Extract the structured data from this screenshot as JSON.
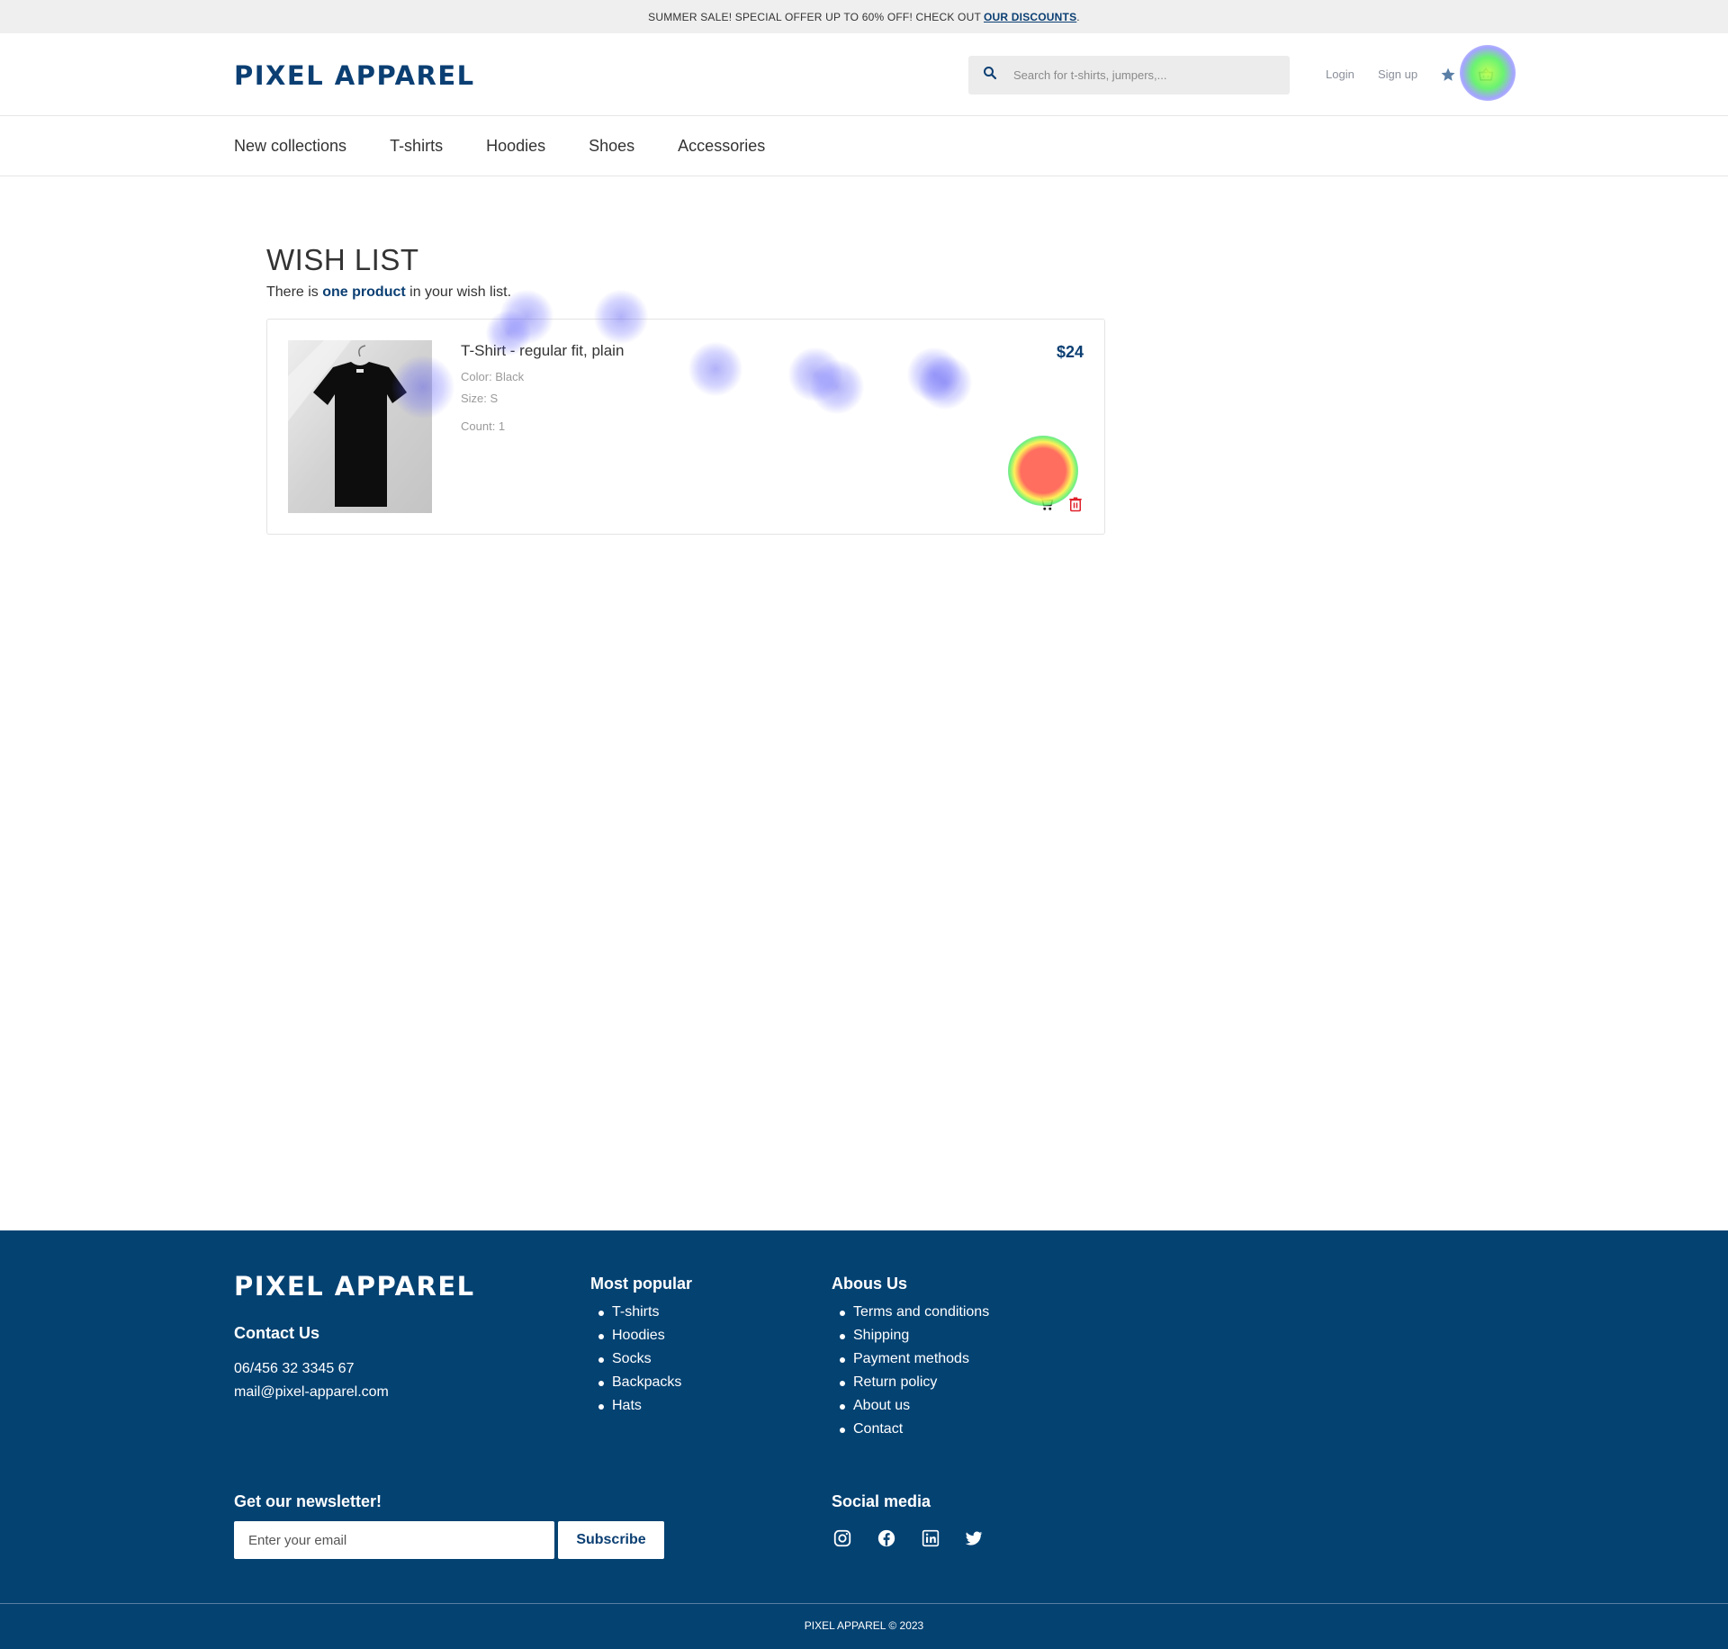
{
  "promo": {
    "text": "SUMMER SALE! SPECIAL OFFER UP TO 60% OFF! CHECK OUT",
    "link": "OUR DISCOUNTS",
    "end": "."
  },
  "header": {
    "logo": "PIXEL APPAREL",
    "search_placeholder": "Search for t-shirts, jumpers,...",
    "login": "Login",
    "signup": "Sign up"
  },
  "nav": {
    "items": [
      "New collections",
      "T-shirts",
      "Hoodies",
      "Shoes",
      "Accessories"
    ]
  },
  "wishlist": {
    "title": "WISH LIST",
    "subtitle_pre": "There is ",
    "subtitle_bold": "one product",
    "subtitle_post": " in your wish list.",
    "item": {
      "name": "T-Shirt - regular fit, plain",
      "color": "Color: Black",
      "size": "Size: S",
      "count": "Count: 1",
      "price": "$24"
    }
  },
  "footer": {
    "logo": "PIXEL APPAREL",
    "contact_title": "Contact Us",
    "phone": "06/456 32 3345 67",
    "email": "mail@pixel-apparel.com",
    "popular_title": "Most popular",
    "popular": [
      "T-shirts",
      "Hoodies",
      "Socks",
      "Backpacks",
      "Hats"
    ],
    "about_title": "Abous Us",
    "about": [
      "Terms and conditions",
      "Shipping",
      "Payment methods",
      "Return policy",
      "About us",
      "Contact"
    ],
    "newsletter_title": "Get our newsletter!",
    "newsletter_placeholder": "Enter your email",
    "subscribe": "Subscribe",
    "social_title": "Social media",
    "copyright": "PIXEL APPAREL © 2023"
  },
  "colors": {
    "brand": "#0b3f73",
    "footer_bg": "#044272",
    "delete": "#e0202a",
    "promo_bg": "#efefef"
  },
  "icons": [
    "search-icon",
    "star-icon",
    "basket-icon",
    "cart-icon",
    "trash-icon",
    "instagram-icon",
    "facebook-icon",
    "linkedin-icon",
    "twitter-icon"
  ]
}
